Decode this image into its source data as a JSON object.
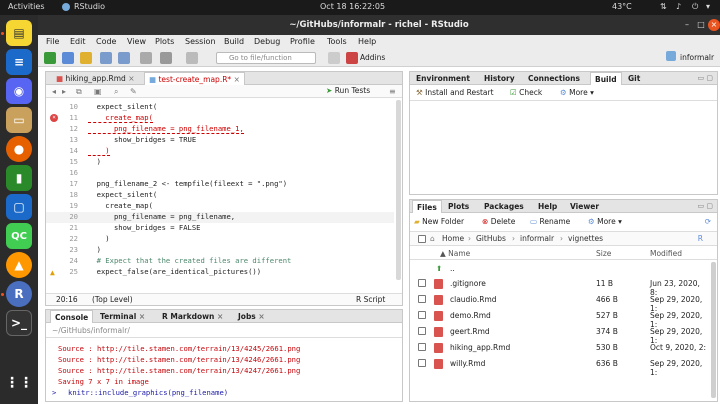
{
  "topbar": {
    "activities": "Activities",
    "app": "RStudio",
    "datetime": "Oct 18  16:22:05",
    "temp": "43°C"
  },
  "window": {
    "title": "~/GitHubs/informalr - richel - RStudio"
  },
  "menu": [
    "File",
    "Edit",
    "Code",
    "View",
    "Plots",
    "Session",
    "Build",
    "Debug",
    "Profile",
    "Tools",
    "Help"
  ],
  "toolbar": {
    "goto_placeholder": "Go to file/function",
    "addins": "Addins",
    "project": "informalr"
  },
  "editor": {
    "tabs": [
      "hiking_app.Rmd",
      "test-create_map.R*"
    ],
    "run_tests": "Run Tests",
    "lines": [
      {
        "n": "10",
        "t": "  expect_silent("
      },
      {
        "n": "11",
        "t": "    create_map("
      },
      {
        "n": "12",
        "t": "      png_filename = png_filename_1,"
      },
      {
        "n": "13",
        "t": "      show_bridges = TRUE"
      },
      {
        "n": "14",
        "t": "    )"
      },
      {
        "n": "15",
        "t": "  )"
      },
      {
        "n": "16",
        "t": ""
      },
      {
        "n": "17",
        "t": "  png_filename_2 <- tempfile(fileext = \".png\")"
      },
      {
        "n": "18",
        "t": "  expect_silent("
      },
      {
        "n": "19",
        "t": "    create_map("
      },
      {
        "n": "20",
        "t": "      png_filename = png_filename,"
      },
      {
        "n": "21",
        "t": "      show_bridges = FALSE"
      },
      {
        "n": "22",
        "t": "    )"
      },
      {
        "n": "23",
        "t": "  )"
      },
      {
        "n": "24",
        "t": "  # Expect that the created files are different"
      },
      {
        "n": "25",
        "t": "  expect_false(are_identical_pictures())"
      }
    ],
    "status_pos": "20:16",
    "status_scope": "(Top Level)",
    "status_type": "R Script"
  },
  "console": {
    "tabs": [
      "Console",
      "Terminal",
      "R Markdown",
      "Jobs"
    ],
    "path": "~/GitHubs/informalr/",
    "lines": [
      "Source : http://tile.stamen.com/terrain/13/4245/2661.png",
      "Source : http://tile.stamen.com/terrain/13/4246/2661.png",
      "Source : http://tile.stamen.com/terrain/13/4247/2661.png",
      "Saving 7 x 7 in image"
    ],
    "prompt": ">",
    "input": "knitr::include_graphics(png_filename)"
  },
  "env": {
    "tabs": [
      "Environment",
      "History",
      "Connections",
      "Build",
      "Git"
    ],
    "install": "Install and Restart",
    "check": "Check",
    "more": "More"
  },
  "files": {
    "tabs": [
      "Files",
      "Plots",
      "Packages",
      "Help",
      "Viewer"
    ],
    "new_folder": "New Folder",
    "delete": "Delete",
    "rename": "Rename",
    "more": "More",
    "breadcrumb": [
      "Home",
      "GitHubs",
      "informalr",
      "vignettes"
    ],
    "headers": {
      "name": "Name",
      "size": "Size",
      "modified": "Modified"
    },
    "up": "..",
    "rows": [
      {
        "name": ".gitignore",
        "size": "11 B",
        "modified": "Jun 23, 2020, 8:"
      },
      {
        "name": "claudio.Rmd",
        "size": "466 B",
        "modified": "Sep 29, 2020, 1:"
      },
      {
        "name": "demo.Rmd",
        "size": "527 B",
        "modified": "Sep 29, 2020, 1:"
      },
      {
        "name": "geert.Rmd",
        "size": "374 B",
        "modified": "Sep 29, 2020, 1:"
      },
      {
        "name": "hiking_app.Rmd",
        "size": "530 B",
        "modified": "Oct 9, 2020, 2:"
      },
      {
        "name": "willy.Rmd",
        "size": "636 B",
        "modified": "Sep 29, 2020, 1:"
      }
    ]
  },
  "colors": {
    "accent": "#e95420",
    "rmd": "#d9534f",
    "console_red": "#c5060b"
  }
}
